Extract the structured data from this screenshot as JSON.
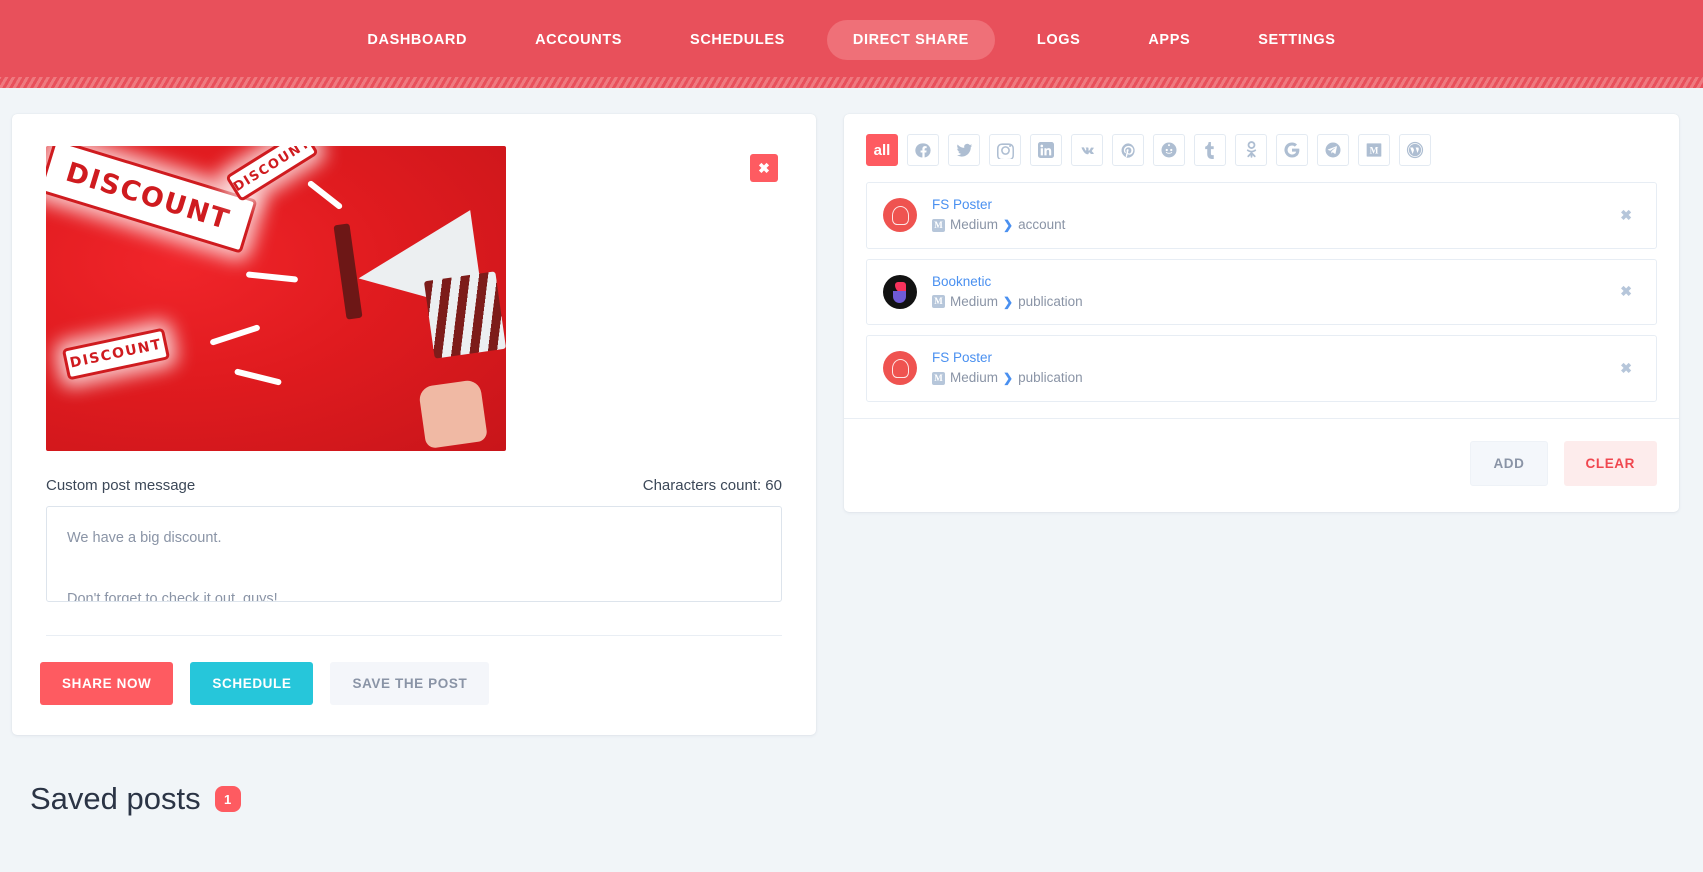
{
  "nav": {
    "items": [
      {
        "label": "DASHBOARD",
        "active": false
      },
      {
        "label": "ACCOUNTS",
        "active": false
      },
      {
        "label": "SCHEDULES",
        "active": false
      },
      {
        "label": "DIRECT SHARE",
        "active": true
      },
      {
        "label": "LOGS",
        "active": false
      },
      {
        "label": "APPS",
        "active": false
      },
      {
        "label": "SETTINGS",
        "active": false
      }
    ]
  },
  "compose": {
    "remove_media_label": "✖",
    "media_alt": "DISCOUNT megaphone promotional image",
    "stamps": [
      "DISCOUNT",
      "DISCOUNT",
      "DISCOUNT"
    ],
    "message_label": "Custom post message",
    "characters_count": "Characters count: 60",
    "message_value": "We have a big discount.\n\nDon't forget to check it out, guys!",
    "message_placeholder": "Custom post message",
    "buttons": {
      "share_now": "SHARE NOW",
      "schedule": "SCHEDULE",
      "save_the_post": "SAVE THE POST"
    }
  },
  "saved": {
    "title": "Saved posts",
    "count": "1"
  },
  "platforms": [
    {
      "name": "all",
      "label": "all",
      "active": true
    },
    {
      "name": "facebook",
      "label": "",
      "active": false
    },
    {
      "name": "twitter",
      "label": "",
      "active": false
    },
    {
      "name": "instagram",
      "label": "",
      "active": false
    },
    {
      "name": "linkedin",
      "label": "",
      "active": false
    },
    {
      "name": "vk",
      "label": "",
      "active": false
    },
    {
      "name": "pinterest",
      "label": "",
      "active": false
    },
    {
      "name": "reddit",
      "label": "",
      "active": false
    },
    {
      "name": "tumblr",
      "label": "",
      "active": false
    },
    {
      "name": "odnoklassniki",
      "label": "",
      "active": false
    },
    {
      "name": "google",
      "label": "",
      "active": false
    },
    {
      "name": "telegram",
      "label": "",
      "active": false
    },
    {
      "name": "medium",
      "label": "",
      "active": false
    },
    {
      "name": "wordpress",
      "label": "",
      "active": false
    }
  ],
  "accounts": [
    {
      "name": "FS Poster",
      "platform": "Medium",
      "type": "account",
      "avatar": "fs",
      "badge": "M",
      "remove": "✖"
    },
    {
      "name": "Booknetic",
      "platform": "Medium",
      "type": "publication",
      "avatar": "bk",
      "badge": "M",
      "remove": "✖"
    },
    {
      "name": "FS Poster",
      "platform": "Medium",
      "type": "publication",
      "avatar": "fs",
      "badge": "M",
      "remove": "✖"
    }
  ],
  "right_actions": {
    "add": "ADD",
    "clear": "CLEAR"
  },
  "colors": {
    "brand_red": "#e8505b",
    "accent_red": "#fe5b61",
    "accent_cyan": "#26c6da",
    "link_blue": "#4a90f0",
    "page_bg": "#f1f5f8"
  }
}
